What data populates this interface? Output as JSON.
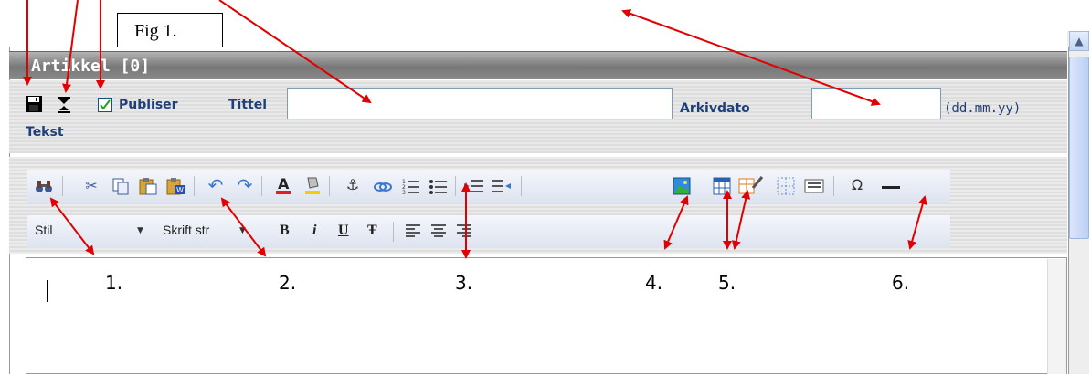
{
  "figure_label": "Fig 1.",
  "window": {
    "title": "Artikkel [0]"
  },
  "form": {
    "publish_label": "Publiser",
    "publish_checked": true,
    "title_label": "Tittel",
    "title_value": "",
    "archive_date_label": "Arkivdato",
    "archive_date_value": "",
    "date_format_hint": "(dd.mm.yy)",
    "text_label": "Tekst"
  },
  "toolbar2": {
    "style_select_value": "Stil",
    "font_size_select_value": "Skrift str",
    "bold": "B",
    "italic": "i",
    "underline": "U",
    "strike": "Ŧ"
  },
  "callouts": [
    "1.",
    "2.",
    "3.",
    "4.",
    "5.",
    "6."
  ],
  "icons": {
    "save": "save-icon",
    "sort": "sort-icon",
    "find": "binoculars-icon",
    "cut": "cut-icon",
    "copy": "copy-icon",
    "paste": "paste-icon",
    "paste_word": "paste-from-word-icon",
    "undo": "undo-icon",
    "redo": "redo-icon",
    "text_color": "text-color-icon",
    "bg_color": "background-color-icon",
    "anchor": "anchor-icon",
    "link": "link-icon",
    "ordered_list": "ordered-list-icon",
    "unordered_list": "unordered-list-icon",
    "indent": "indent-icon",
    "outdent": "outdent-icon",
    "image": "image-icon",
    "table": "table-icon",
    "table_edit": "table-edit-icon",
    "table_grid": "table-grid-icon",
    "div": "div-icon",
    "special_char": "omega-icon",
    "horizontal_rule": "horizontal-rule-icon"
  },
  "colors": {
    "label_blue": "#1f3f7a",
    "arrow_red": "#e00000",
    "titlebar_gray": "#8a8a8a"
  }
}
